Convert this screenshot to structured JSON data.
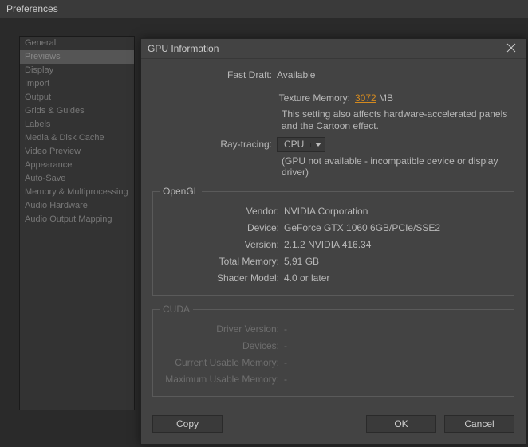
{
  "window": {
    "title": "Preferences"
  },
  "sidebar": {
    "items": [
      {
        "label": "General"
      },
      {
        "label": "Previews"
      },
      {
        "label": "Display"
      },
      {
        "label": "Import"
      },
      {
        "label": "Output"
      },
      {
        "label": "Grids & Guides"
      },
      {
        "label": "Labels"
      },
      {
        "label": "Media & Disk Cache"
      },
      {
        "label": "Video Preview"
      },
      {
        "label": "Appearance"
      },
      {
        "label": "Auto-Save"
      },
      {
        "label": "Memory & Multiprocessing"
      },
      {
        "label": "Audio Hardware"
      },
      {
        "label": "Audio Output Mapping"
      }
    ],
    "selectedIndex": 1
  },
  "modal": {
    "title": "GPU Information",
    "fastDraft": {
      "label": "Fast Draft:",
      "value": "Available"
    },
    "textureMemory": {
      "label": "Texture Memory:",
      "value": "3072",
      "unit": " MB"
    },
    "textureNote": "This setting also affects hardware-accelerated panels and the Cartoon effect.",
    "rayTracing": {
      "label": "Ray-tracing:",
      "value": "CPU"
    },
    "gpuNote": "(GPU not available - incompatible device or display driver)",
    "opengl": {
      "legend": "OpenGL",
      "vendor": {
        "label": "Vendor:",
        "value": "NVIDIA Corporation"
      },
      "device": {
        "label": "Device:",
        "value": "GeForce GTX 1060 6GB/PCIe/SSE2"
      },
      "version": {
        "label": "Version:",
        "value": "2.1.2 NVIDIA 416.34"
      },
      "totalMemory": {
        "label": "Total Memory:",
        "value": "5,91 GB"
      },
      "shaderModel": {
        "label": "Shader Model:",
        "value": "4.0 or later"
      }
    },
    "cuda": {
      "legend": "CUDA",
      "driverVersion": {
        "label": "Driver Version:",
        "value": "-"
      },
      "devices": {
        "label": "Devices:",
        "value": "-"
      },
      "currentUsable": {
        "label": "Current Usable Memory:",
        "value": "-"
      },
      "maximumUsable": {
        "label": "Maximum Usable Memory:",
        "value": "-"
      }
    },
    "buttons": {
      "copy": "Copy",
      "ok": "OK",
      "cancel": "Cancel"
    }
  }
}
